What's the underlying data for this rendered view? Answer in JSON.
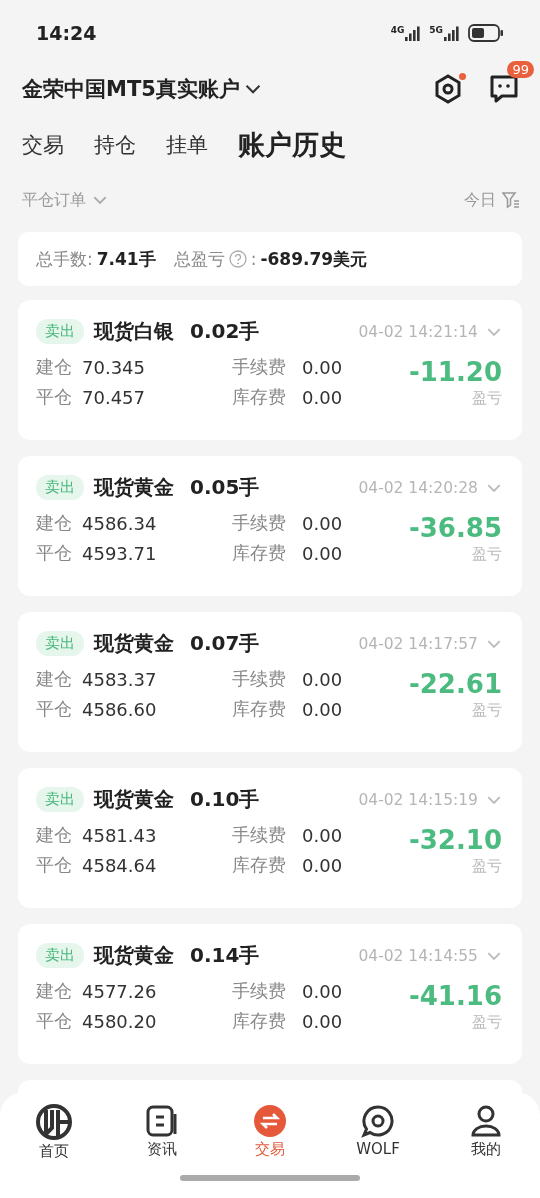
{
  "status_bar": {
    "time": "14:24",
    "network_1": "4G",
    "network_2": "5G"
  },
  "header": {
    "account": "金荣中国MT5真实账户",
    "settings_dot": true,
    "message_badge": "99"
  },
  "tabs": [
    {
      "label": "交易",
      "selected": false
    },
    {
      "label": "持仓",
      "selected": false
    },
    {
      "label": "挂单",
      "selected": false
    },
    {
      "label": "账户历史",
      "selected": true
    }
  ],
  "filter": {
    "order_type": "平仓订单",
    "period": "今日"
  },
  "summary": {
    "lots_label": "总手数:",
    "lots": "7.41手",
    "pnl_label": "总盈亏",
    "pnl_colon": ":",
    "pnl": "-689.79美元"
  },
  "orders": [
    {
      "side": "卖出",
      "symbol": "现货白银",
      "lots": "0.02手",
      "time": "04-02 14:21:14",
      "open_label": "建仓",
      "open": "70.345",
      "close_label": "平仓",
      "close": "70.457",
      "fee_label": "手续费",
      "fee": "0.00",
      "swap_label": "库存费",
      "swap": "0.00",
      "pnl": "-11.20",
      "pnl_label": "盈亏"
    },
    {
      "side": "卖出",
      "symbol": "现货黄金",
      "lots": "0.05手",
      "time": "04-02 14:20:28",
      "open_label": "建仓",
      "open": "4586.34",
      "close_label": "平仓",
      "close": "4593.71",
      "fee_label": "手续费",
      "fee": "0.00",
      "swap_label": "库存费",
      "swap": "0.00",
      "pnl": "-36.85",
      "pnl_label": "盈亏"
    },
    {
      "side": "卖出",
      "symbol": "现货黄金",
      "lots": "0.07手",
      "time": "04-02 14:17:57",
      "open_label": "建仓",
      "open": "4583.37",
      "close_label": "平仓",
      "close": "4586.60",
      "fee_label": "手续费",
      "fee": "0.00",
      "swap_label": "库存费",
      "swap": "0.00",
      "pnl": "-22.61",
      "pnl_label": "盈亏"
    },
    {
      "side": "卖出",
      "symbol": "现货黄金",
      "lots": "0.10手",
      "time": "04-02 14:15:19",
      "open_label": "建仓",
      "open": "4581.43",
      "close_label": "平仓",
      "close": "4584.64",
      "fee_label": "手续费",
      "fee": "0.00",
      "swap_label": "库存费",
      "swap": "0.00",
      "pnl": "-32.10",
      "pnl_label": "盈亏"
    },
    {
      "side": "卖出",
      "symbol": "现货黄金",
      "lots": "0.14手",
      "time": "04-02 14:14:55",
      "open_label": "建仓",
      "open": "4577.26",
      "close_label": "平仓",
      "close": "4580.20",
      "fee_label": "手续费",
      "fee": "0.00",
      "swap_label": "库存费",
      "swap": "0.00",
      "pnl": "-41.16",
      "pnl_label": "盈亏"
    }
  ],
  "bottom_nav": [
    {
      "kind": "home",
      "label": "首页",
      "selected": false
    },
    {
      "kind": "news",
      "label": "资讯",
      "selected": false
    },
    {
      "kind": "trade",
      "label": "交易",
      "selected": true
    },
    {
      "kind": "community",
      "label": "WOLF",
      "selected": false
    },
    {
      "kind": "profile",
      "label": "我的",
      "selected": false
    }
  ]
}
